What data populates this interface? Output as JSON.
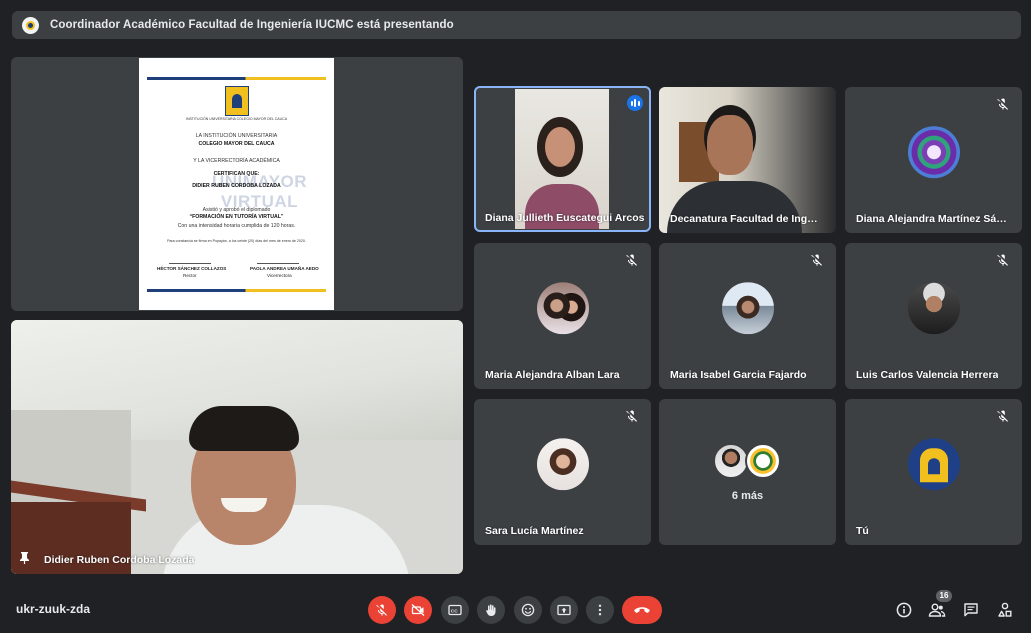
{
  "banner": {
    "text": "Coordinador Académico Facultad de Ingeniería IUCMC está presentando"
  },
  "presentation": {
    "doc": {
      "logo_caption": "INSTITUCIÓN UNIVERSITARIA COLEGIO MAYOR DEL CAUCA",
      "line1": "LA INSTITUCIÓN UNIVERSITARIA",
      "line2": "COLEGIO MAYOR DEL CAUCA",
      "line3": "Y LA VICERRECTORÍA ACADÉMICA",
      "line4": "CERTIFICAN QUE:",
      "line5": "DIDIER RUBEN CORDOBA LOZADA",
      "line6": "Asistió y aprobó el diplomado",
      "line7": "“FORMACIÓN EN TUTORÍA VIRTUAL”",
      "line8": "Con una intensidad horaria cumplida de 120 horas.",
      "line9": "Para constancia se firma en Popayán, a los veinte (20) días del mes de enero de 2020.",
      "watermark": "UNIMAYOR VIRTUAL",
      "sig1_name": "HÉCTOR SÁNCHEZ COLLAZOS",
      "sig1_role": "Rector",
      "sig2_name": "PAOLA ANDREA UMAÑA AEDO",
      "sig2_role": "Vicerrectora"
    }
  },
  "speaker": {
    "name": "Didier Ruben Cordoba Lozada"
  },
  "participants": [
    {
      "name": "Diana Jullieth Euscategui Arcos"
    },
    {
      "name": "Decanatura Facultad de Ingeniería"
    },
    {
      "name": "Diana Alejandra Martínez Sánchez"
    },
    {
      "name": "Maria Alejandra Alban Lara"
    },
    {
      "name": "Maria Isabel Garcia Fajardo"
    },
    {
      "name": "Luis Carlos Valencia Herrera"
    },
    {
      "name": "Sara Lucía Martínez"
    },
    {
      "more": "6 más"
    },
    {
      "name": "Tú"
    }
  ],
  "bottom": {
    "meeting_code": "ukr-zuuk-zda",
    "people_count": "16"
  },
  "icons": {
    "mic": "mic-off-icon",
    "cam": "camera-off-icon",
    "cc": "captions-icon",
    "hand": "raise-hand-icon",
    "emoji": "emoji-icon",
    "present": "present-icon",
    "more": "more-options-icon",
    "hangup": "hangup-icon",
    "info": "info-icon",
    "people": "people-icon",
    "chat": "chat-icon",
    "activities": "activities-icon"
  },
  "colors": {
    "background": "#202124",
    "tile": "#3c4043",
    "active_border": "#8ab4f8",
    "danger": "#ea4335"
  }
}
